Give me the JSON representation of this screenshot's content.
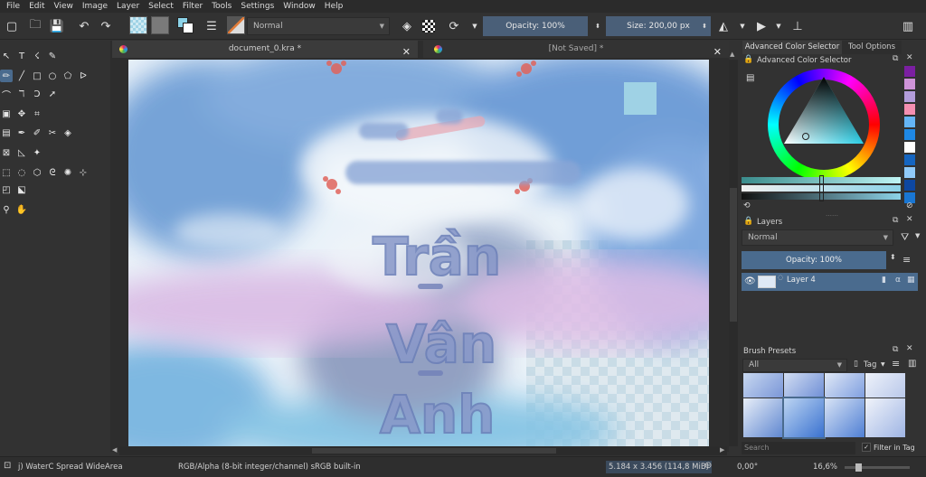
{
  "menu": [
    "File",
    "Edit",
    "View",
    "Image",
    "Layer",
    "Select",
    "Filter",
    "Tools",
    "Settings",
    "Window",
    "Help"
  ],
  "toolbar": {
    "blend_mode": "Normal",
    "opacity_label": "Opacity: 100%",
    "size_label": "Size: 200,00 px"
  },
  "documents": {
    "tab1_title": "document_0.kra *",
    "tab2_title": "[Not Saved]  *"
  },
  "canvas_text": {
    "line1": "Trần",
    "line2": "Vân",
    "line3": "Anh"
  },
  "dock": {
    "tab_color_selector": "Advanced Color Selector",
    "tab_tool_options": "Tool Options",
    "color_selector_title": "Advanced Color Selector",
    "layers_title": "Layers",
    "layers_blend": "Normal",
    "layers_opacity": "Opacity:  100%",
    "layer_name": "Layer 4",
    "brush_presets_title": "Brush Presets",
    "brush_filter": "All",
    "brush_tag": "Tag",
    "search_placeholder": "Search",
    "filter_in_tag": "Filter in Tag"
  },
  "status": {
    "brush_name": "j) WaterC Spread WideArea",
    "color_space": "RGB/Alpha (8-bit integer/channel)  sRGB built-in",
    "image_size": "5.184 x 3.456 (114,8 MiB)",
    "rotation": "0,00°",
    "zoom": "16,6%"
  },
  "colors": {
    "accent": "#4a6b8e",
    "bg": "#323232",
    "fg_swatch": "#8cd3e8",
    "history_swatches": [
      "#7b1fa2",
      "#ce93d8",
      "#b39ddb",
      "#f48fb1",
      "#64b5f6",
      "#1e88e5",
      "#ffffff",
      "#1565c0",
      "#90caf9",
      "#0d47a1",
      "#1976d2"
    ]
  }
}
